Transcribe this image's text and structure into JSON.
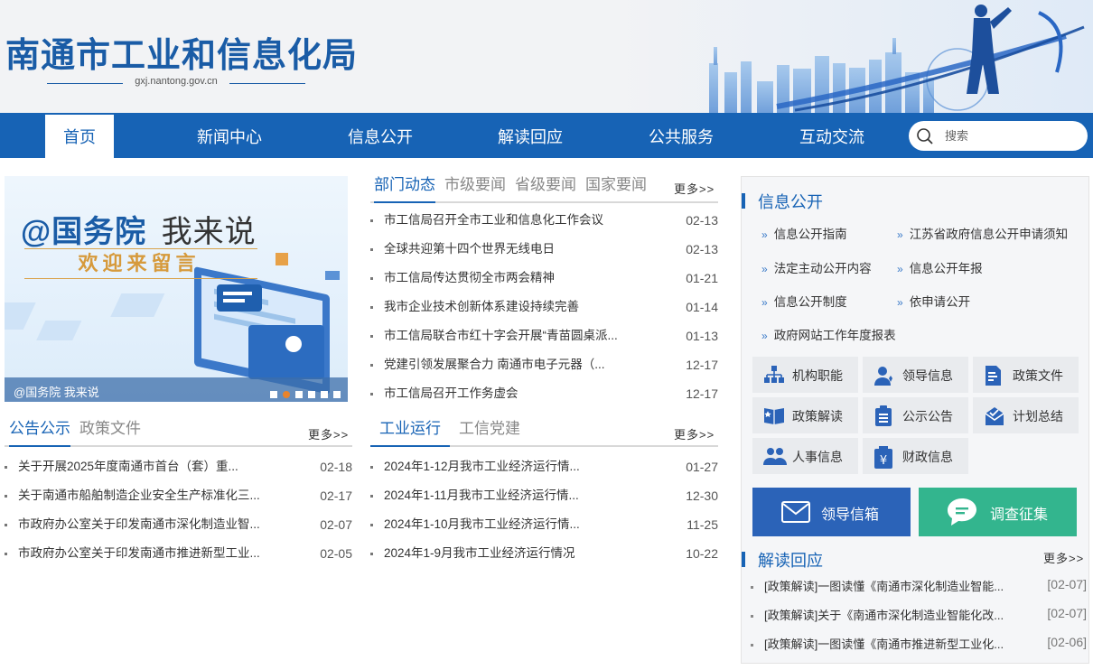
{
  "header": {
    "title": "南通市工业和信息化局",
    "domain": "gxj.nantong.gov.cn"
  },
  "nav": {
    "items": [
      "首页",
      "新闻中心",
      "信息公开",
      "解读回应",
      "公共服务",
      "互动交流"
    ],
    "active": "首页",
    "search_placeholder": "搜索"
  },
  "carousel": {
    "title_at": "@国务院",
    "title_rest": "我来说",
    "subtitle": "欢迎来留言",
    "caption": "@国务院 我来说",
    "dot_count": 6,
    "active_dot": 2
  },
  "news": {
    "tabs": [
      "部门动态",
      "市级要闻",
      "省级要闻",
      "国家要闻"
    ],
    "more": "更多>>",
    "items": [
      {
        "title": "市工信局召开全市工业和信息化工作会议",
        "date": "02-13"
      },
      {
        "title": "全球共迎第十四个世界无线电日",
        "date": "02-13"
      },
      {
        "title": "市工信局传达贯彻全市两会精神",
        "date": "01-21"
      },
      {
        "title": "我市企业技术创新体系建设持续完善",
        "date": "01-14"
      },
      {
        "title": "市工信局联合市红十字会开展“青苗圆桌派...",
        "date": "01-13"
      },
      {
        "title": "党建引领发展聚合力 南通市电子元器（...",
        "date": "12-17"
      },
      {
        "title": "市工信局召开工作务虚会",
        "date": "12-17"
      }
    ]
  },
  "notices": {
    "tabs": [
      "公告公示",
      "政策文件"
    ],
    "more": "更多>>",
    "items": [
      {
        "title": "关于开展2025年度南通市首台（套）重...",
        "date": "02-18"
      },
      {
        "title": "关于南通市船舶制造企业安全生产标准化三...",
        "date": "02-17"
      },
      {
        "title": "市政府办公室关于印发南通市深化制造业智...",
        "date": "02-07"
      },
      {
        "title": "市政府办公室关于印发南通市推进新型工业...",
        "date": "02-05"
      }
    ]
  },
  "industry": {
    "tabs": [
      "工业运行",
      "工信党建"
    ],
    "more": "更多>>",
    "items": [
      {
        "title": "2024年1-12月我市工业经济运行情...",
        "date": "01-27"
      },
      {
        "title": "2024年1-11月我市工业经济运行情...",
        "date": "12-30"
      },
      {
        "title": "2024年1-10月我市工业经济运行情...",
        "date": "11-25"
      },
      {
        "title": "2024年1-9月我市工业经济运行情况",
        "date": "10-22"
      }
    ]
  },
  "sidebar": {
    "info_title": "信息公开",
    "links": [
      "信息公开指南",
      "江苏省政府信息公开申请须知",
      "法定主动公开内容",
      "信息公开年报",
      "信息公开制度",
      "依申请公开",
      "政府网站工作年度报表"
    ],
    "grid": [
      {
        "label": "机构职能",
        "icon": "org-chart-icon"
      },
      {
        "label": "领导信息",
        "icon": "leader-icon"
      },
      {
        "label": "政策文件",
        "icon": "document-icon"
      },
      {
        "label": "政策解读",
        "icon": "book-icon"
      },
      {
        "label": "公示公告",
        "icon": "clipboard-icon"
      },
      {
        "label": "计划总结",
        "icon": "summary-icon"
      },
      {
        "label": "人事信息",
        "icon": "people-icon"
      },
      {
        "label": "财政信息",
        "icon": "finance-icon"
      }
    ],
    "mailbox_label": "领导信箱",
    "survey_label": "调查征集",
    "jd_title": "解读回应",
    "jd_more": "更多>>",
    "jd_items": [
      {
        "title": "[政策解读]一图读懂《南通市深化制造业智能...",
        "date": "[02-07]"
      },
      {
        "title": "[政策解读]关于《南通市深化制造业智能化改...",
        "date": "[02-07]"
      },
      {
        "title": "[政策解读]一图读懂《南通市推进新型工业化...",
        "date": "[02-06]"
      }
    ],
    "colors": {
      "mailbox": "#2b63b8",
      "survey": "#33b58e",
      "accent": "#1763b5"
    }
  }
}
